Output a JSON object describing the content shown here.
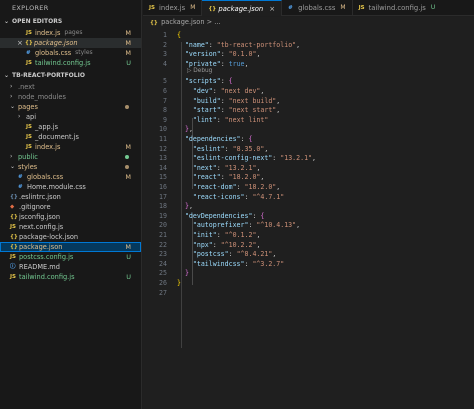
{
  "sidebar": {
    "title": "EXPLORER",
    "open_editors": {
      "label": "OPEN EDITORS",
      "items": [
        {
          "name": "index.js",
          "extra": "pages",
          "icon": "JS",
          "badge": "M"
        },
        {
          "name": "package.json",
          "extra": "",
          "icon": "{}",
          "badge": "M",
          "close": "×"
        },
        {
          "name": "globals.css",
          "extra": "styles",
          "icon": "#",
          "badge": "M"
        },
        {
          "name": "tailwind.config.js",
          "extra": "",
          "icon": "JS",
          "badge": "U"
        }
      ]
    },
    "project": {
      "label": "TB-REACT-PORTFOLIO",
      "items": [
        {
          "name": ".next",
          "chev": "›"
        },
        {
          "name": "node_modules",
          "chev": "›"
        },
        {
          "name": "pages",
          "chev": "⌄"
        },
        {
          "name": "api",
          "chev": "›"
        },
        {
          "name": "_app.js",
          "icon": "JS"
        },
        {
          "name": "_document.js",
          "icon": "JS"
        },
        {
          "name": "index.js",
          "icon": "JS",
          "badge": "M"
        },
        {
          "name": "public",
          "chev": "›"
        },
        {
          "name": "styles",
          "chev": "⌄"
        },
        {
          "name": "globals.css",
          "icon": "#",
          "badge": "M"
        },
        {
          "name": "Home.module.css",
          "icon": "#"
        },
        {
          "name": ".eslintrc.json",
          "icon": "{}"
        },
        {
          "name": ".gitignore",
          "icon": "◆"
        },
        {
          "name": "jsconfig.json",
          "icon": "{}"
        },
        {
          "name": "next.config.js",
          "icon": "JS"
        },
        {
          "name": "package-lock.json",
          "icon": "{}"
        },
        {
          "name": "package.json",
          "icon": "{}",
          "badge": "M"
        },
        {
          "name": "postcss.config.js",
          "icon": "JS",
          "badge": "U"
        },
        {
          "name": "README.md",
          "icon": "ⓘ"
        },
        {
          "name": "tailwind.config.js",
          "icon": "JS",
          "badge": "U"
        }
      ]
    }
  },
  "tabs": [
    {
      "label": "index.js",
      "icon": "JS",
      "badge": "M"
    },
    {
      "label": "package.json",
      "icon": "{}",
      "badge": "×"
    },
    {
      "label": "globals.css",
      "icon": "#",
      "badge": "M"
    },
    {
      "label": "tailwind.config.js",
      "icon": "JS",
      "badge": "U"
    }
  ],
  "breadcrumb": {
    "file": "package.json",
    "icon": "{}",
    "rest": "> ..."
  },
  "editor": {
    "line_numbers": [
      "1",
      "2",
      "3",
      "4",
      "5",
      "6",
      "7",
      "8",
      "9",
      "10",
      "11",
      "12",
      "13",
      "14",
      "15",
      "16",
      "17",
      "18",
      "19",
      "20",
      "21",
      "22",
      "23",
      "24",
      "25",
      "26",
      "27"
    ],
    "codelens": "▷ Debug",
    "lines": [
      "{",
      "  \"name\": \"tb-react-portfolio\",",
      "  \"version\": \"0.1.0\",",
      "  \"private\": true,",
      "  \"scripts\": {",
      "    \"dev\": \"next dev\",",
      "    \"build\": \"next build\",",
      "    \"start\": \"next start\",",
      "    \"lint\": \"next lint\"",
      "  },",
      "  \"dependencies\": {",
      "    \"eslint\": \"8.35.0\",",
      "    \"eslint-config-next\": \"13.2.1\",",
      "    \"next\": \"13.2.1\",",
      "    \"react\": \"18.2.0\",",
      "    \"react-dom\": \"18.2.0\",",
      "    \"react-icons\": \"^4.7.1\"",
      "  },",
      "  \"devDependencies\": {",
      "    \"autoprefixer\": \"^10.4.13\",",
      "    \"init\": \"^0.1.2\",",
      "    \"npx\": \"^10.2.2\",",
      "    \"postcss\": \"^8.4.21\",",
      "    \"tailwindcss\": \"^3.2.7\"",
      "  }",
      "}",
      ""
    ]
  }
}
